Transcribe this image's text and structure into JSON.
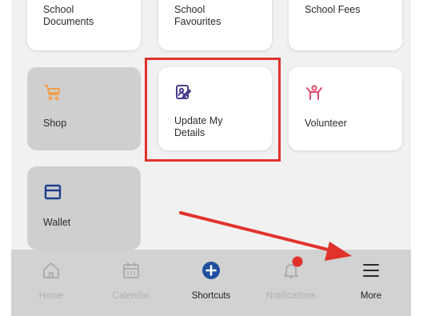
{
  "cards": {
    "school_documents": "School\nDocuments",
    "school_favourites": "School\nFavourites",
    "school_fees": "School Fees",
    "shop": "Shop",
    "update_details": "Update My\nDetails",
    "volunteer": "Volunteer",
    "wallet": "Wallet"
  },
  "nav": {
    "home": "Home",
    "calendar": "Calendar",
    "shortcuts": "Shortcuts",
    "notifications": "Notifications",
    "more": "More"
  },
  "colors": {
    "shop_icon": "#f0a04b",
    "update_icon": "#4b3d8f",
    "volunteer_icon": "#e0476b",
    "wallet_icon": "#1f3f8f",
    "shortcuts_icon": "#1f4fa0",
    "highlight": "#e0332b",
    "arrow": "#e0332b"
  },
  "icons": {
    "shop": "cart-icon",
    "update_details": "edit-profile-icon",
    "volunteer": "volunteer-icon",
    "wallet": "wallet-icon",
    "home": "home-icon",
    "calendar": "calendar-icon",
    "shortcuts": "plus-circle-icon",
    "notifications": "bell-icon",
    "more": "menu-icon"
  }
}
